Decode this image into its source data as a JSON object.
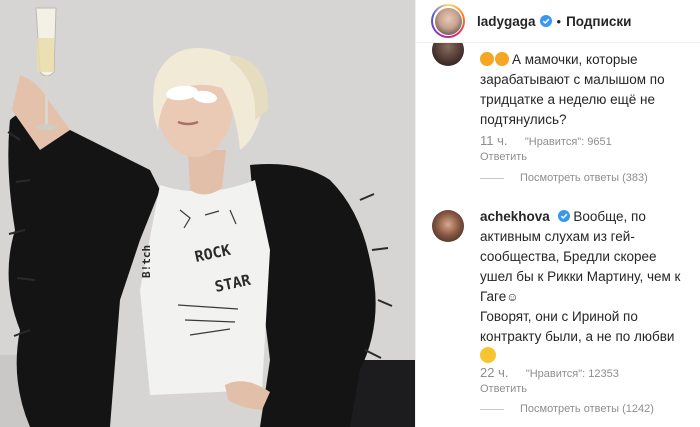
{
  "header": {
    "username": "ladygaga",
    "separator": "•",
    "follow_label": "Подписки"
  },
  "photo": {
    "shirt_text_1": "ROCK",
    "shirt_text_2": "STAR",
    "shirt_text_3": "B!tch"
  },
  "comments": [
    {
      "text": "А мамочки, которые зарабатывают с малышом по тридцатке а неделю ещё не подтянулись?",
      "time": "11 ч.",
      "likes": "\"Нравится\": 9651",
      "reply": "Ответить",
      "view_replies": "Посмотреть ответы (383)"
    },
    {
      "username": "achekhova",
      "text_1": "Вообще, по активным слухам из гей-сообщества, Бредли скорее ушел бы к Рикки Мартину, чем к Гаге",
      "text_2": "Говорят, они с Ириной по контракту были, а не по любви",
      "time": "22 ч.",
      "likes": "\"Нравится\": 12353",
      "reply": "Ответить",
      "view_replies": "Посмотреть ответы (1242)"
    }
  ],
  "colors": {
    "verified_blue": "#3897f0",
    "meta_gray": "#8e8e8e",
    "text": "#262626"
  }
}
